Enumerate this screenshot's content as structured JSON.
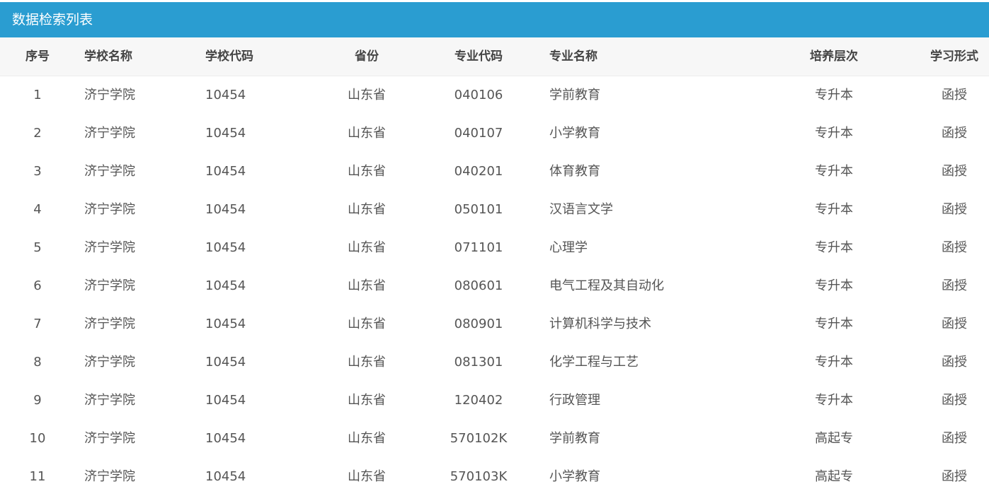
{
  "panel": {
    "title": "数据检索列表"
  },
  "table": {
    "headers": [
      "序号",
      "学校名称",
      "学校代码",
      "省份",
      "专业代码",
      "专业名称",
      "培养层次",
      "学习形式"
    ],
    "rows": [
      [
        "1",
        "济宁学院",
        "10454",
        "山东省",
        "040106",
        "学前教育",
        "专升本",
        "函授"
      ],
      [
        "2",
        "济宁学院",
        "10454",
        "山东省",
        "040107",
        "小学教育",
        "专升本",
        "函授"
      ],
      [
        "3",
        "济宁学院",
        "10454",
        "山东省",
        "040201",
        "体育教育",
        "专升本",
        "函授"
      ],
      [
        "4",
        "济宁学院",
        "10454",
        "山东省",
        "050101",
        "汉语言文学",
        "专升本",
        "函授"
      ],
      [
        "5",
        "济宁学院",
        "10454",
        "山东省",
        "071101",
        "心理学",
        "专升本",
        "函授"
      ],
      [
        "6",
        "济宁学院",
        "10454",
        "山东省",
        "080601",
        "电气工程及其自动化",
        "专升本",
        "函授"
      ],
      [
        "7",
        "济宁学院",
        "10454",
        "山东省",
        "080901",
        "计算机科学与技术",
        "专升本",
        "函授"
      ],
      [
        "8",
        "济宁学院",
        "10454",
        "山东省",
        "081301",
        "化学工程与工艺",
        "专升本",
        "函授"
      ],
      [
        "9",
        "济宁学院",
        "10454",
        "山东省",
        "120402",
        "行政管理",
        "专升本",
        "函授"
      ],
      [
        "10",
        "济宁学院",
        "10454",
        "山东省",
        "570102K",
        "学前教育",
        "高起专",
        "函授"
      ],
      [
        "11",
        "济宁学院",
        "10454",
        "山东省",
        "570103K",
        "小学教育",
        "高起专",
        "函授"
      ]
    ]
  },
  "colors": {
    "title_bar": "#2a9dd1",
    "header_bg": "#f7f7f7",
    "text": "#555555"
  }
}
